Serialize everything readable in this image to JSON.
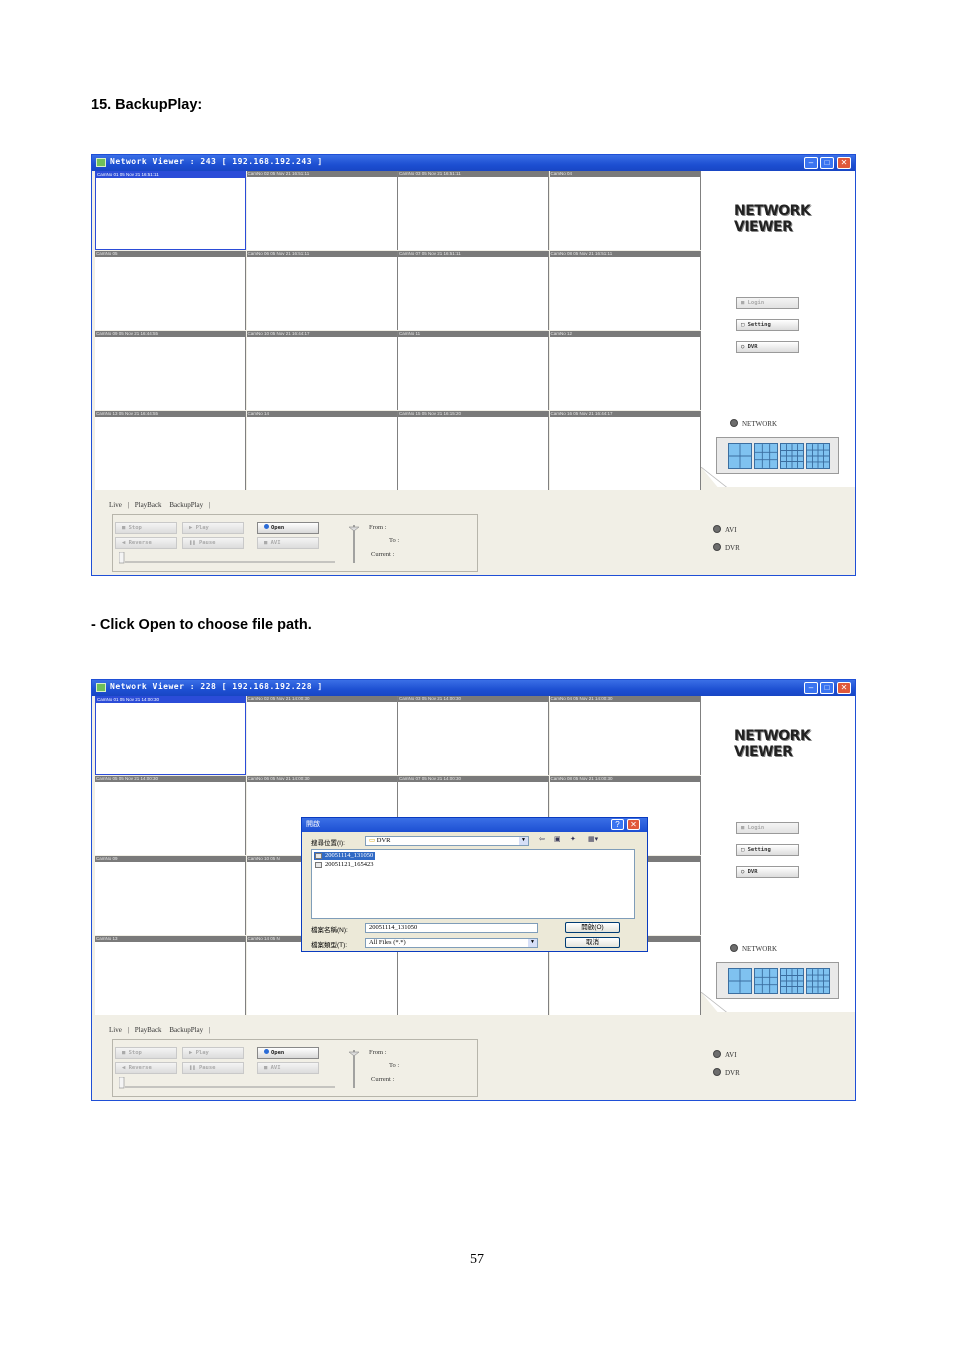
{
  "section_heading": "15. BackupPlay:",
  "instruction": "- Click Open to choose file path.",
  "page_number": "57",
  "screenshots": [
    {
      "window_title": "Network Viewer : 243 [ 192.168.192.243 ]",
      "cameras": [
        "CamNo 01 05 Nov 21 16:51:11",
        "CamNo 02 05 Nov 21 16:51:11",
        "CamNo 03 05 Nov 21 16:51:11",
        "CamNo 04",
        "CamNo 05",
        "CamNo 06 05 Nov 21 16:51:11",
        "CamNo 07 05 Nov 21 16:51:11",
        "CamNo 08 05 Nov 21 16:51:11",
        "CamNo 09 05 Nov 21 16:44:55",
        "CamNo 10 05 Nov 21 16:44:17",
        "CamNo 11",
        "CamNo 12",
        "CamNo 13 05 Nov 21 16:44:55",
        "CamNo 14",
        "CamNo 15 05 Nov 21 16:15:20",
        "CamNo 16 05 Nov 21 16:44:17"
      ]
    },
    {
      "window_title": "Network Viewer : 228 [ 192.168.192.228 ]",
      "cameras": [
        "CamNo 01 05 Nov 21 14:00:30",
        "CamNo 02 05 Nov 21 14:00:30",
        "CamNo 03 05 Nov 21 14:00:30",
        "CamNo 04 05 Nov 21 14:00:30",
        "CamNo 05 05 Nov 21 14:00:30",
        "CamNo 06 05 Nov 21 14:00:30",
        "CamNo 07 05 Nov 21 14:00:30",
        "CamNo 08 05 Nov 21 14:00:30",
        "CamNo 09",
        "CamNo 10 05 N",
        "",
        "",
        "CamNo 13",
        "CamNo 14 05 N",
        "",
        ""
      ],
      "dialog": {
        "title": "開啟",
        "look_in_label": "搜尋位置(I):",
        "look_in_value": "DVR",
        "files": [
          "20051114_131050",
          "20051121_165423"
        ],
        "selected_file_index": 0,
        "filename_label": "檔案名稱(N):",
        "filename_value": "20051114_131050",
        "filetype_label": "檔案類型(T):",
        "filetype_value": "All Files (*.*)",
        "open_button": "開啟(O)",
        "cancel_button": "取消"
      }
    }
  ],
  "brand": {
    "line1": "NETWORK",
    "line2": "VIEWER"
  },
  "side_buttons": {
    "login": "Login",
    "setting": "Setting",
    "dvr": "DVR"
  },
  "network_radio": "NETWORK",
  "avi_radio": "AVI",
  "dvr_radio": "DVR",
  "tabs": {
    "live": "Live",
    "playback": "PlayBack",
    "backupplay": "BackupPlay"
  },
  "controls": {
    "stop": "Stop",
    "play": "Play",
    "open": "Open",
    "reverse": "Reverse",
    "pause": "Pause",
    "avi": "AVI"
  },
  "time_labels": {
    "from": "From :",
    "to": "To :",
    "current": "Current :"
  },
  "colors": {
    "titlebar": "#1d4fd2",
    "selected_cam": "#2b4cd8",
    "panel": "#f1efe6"
  }
}
